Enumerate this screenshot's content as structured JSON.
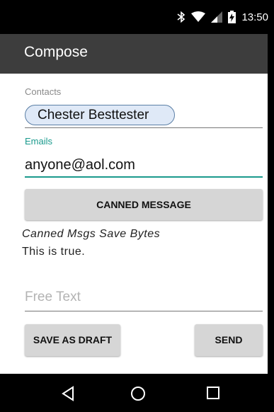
{
  "status_bar": {
    "time": "13:50",
    "icons": [
      "bluetooth-icon",
      "wifi-icon",
      "cell-signal-icon",
      "battery-charging-icon"
    ]
  },
  "app_bar": {
    "title": "Compose"
  },
  "form": {
    "contacts_label": "Contacts",
    "contact_chip": "Chester Besttester",
    "emails_label": "Emails",
    "email_value": "anyone@aol.com",
    "canned_button": "CANNED MESSAGE",
    "canned_title": "Canned Msgs Save Bytes",
    "canned_body": "This is true.",
    "free_text_placeholder": "Free Text",
    "save_draft_button": "SAVE AS DRAFT",
    "send_button": "SEND"
  },
  "nav_bar": {
    "icons": [
      "back-icon",
      "home-icon",
      "recents-icon"
    ]
  },
  "colors": {
    "app_bar": "#3d3d3d",
    "accent": "#1a9a8d",
    "chip_bg": "#dfe9f7",
    "chip_border": "#5b7fa6",
    "button_bg": "#d6d6d6"
  }
}
